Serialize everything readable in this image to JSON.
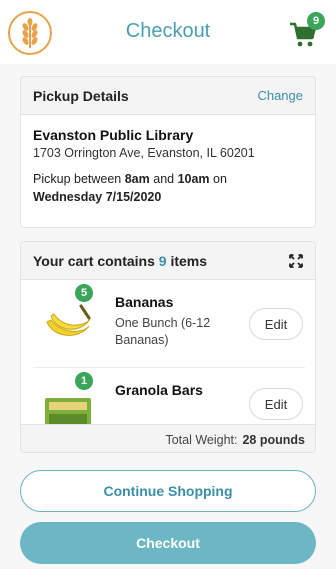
{
  "header": {
    "title": "Checkout",
    "cart_count": "9",
    "logo_icon": "wheat-icon",
    "cart_icon": "shopping-cart-icon"
  },
  "pickup": {
    "heading": "Pickup Details",
    "change_label": "Change",
    "location_name": "Evanston Public Library",
    "address": "1703 Orrington Ave, Evanston, IL 60201",
    "time_prefix": "Pickup between ",
    "time_start": "8am",
    "time_and": " and ",
    "time_end": "10am",
    "time_on": " on",
    "date": "Wednesday 7/15/2020"
  },
  "cart": {
    "heading_prefix": "Your cart contains ",
    "item_count": "9",
    "heading_suffix": " items",
    "expand_icon": "expand-icon",
    "items": [
      {
        "quantity": "5",
        "name": "Bananas",
        "description": "One Bunch (6-12 Bananas)",
        "edit_label": "Edit",
        "image": "bananas-image"
      },
      {
        "quantity": "1",
        "name": "Granola Bars",
        "description": "",
        "edit_label": "Edit",
        "image": "granola-bars-image"
      }
    ],
    "total_label": "Total Weight:",
    "total_value": "28 pounds"
  },
  "actions": {
    "continue_label": "Continue Shopping",
    "checkout_label": "Checkout"
  },
  "colors": {
    "accent": "#4a9fb0",
    "badge_green": "#3aa65a",
    "logo_orange": "#e8a24a",
    "checkout_fill": "#6db7c4"
  }
}
